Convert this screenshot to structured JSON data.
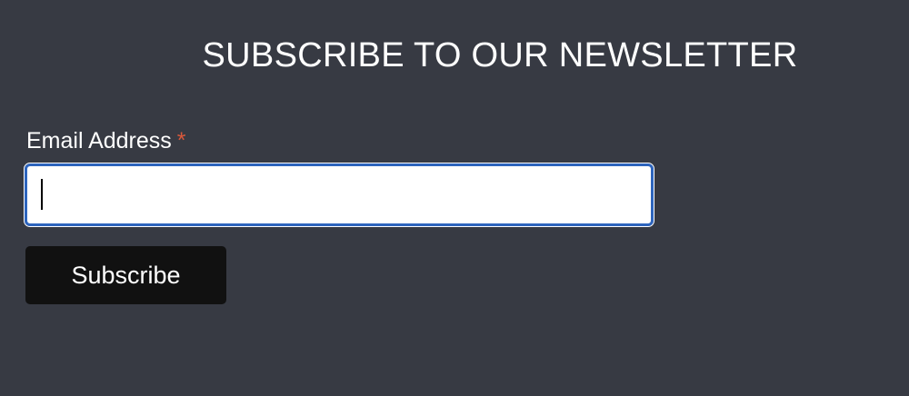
{
  "newsletter": {
    "heading": "SUBSCRIBE TO OUR NEWSLETTER",
    "email_label": "Email Address",
    "required_mark": "*",
    "email_value": "",
    "subscribe_label": "Subscribe"
  },
  "colors": {
    "background": "#373a43",
    "input_focus_border": "#2d64bd",
    "required_mark": "#d9583b",
    "button_bg": "#111111"
  }
}
